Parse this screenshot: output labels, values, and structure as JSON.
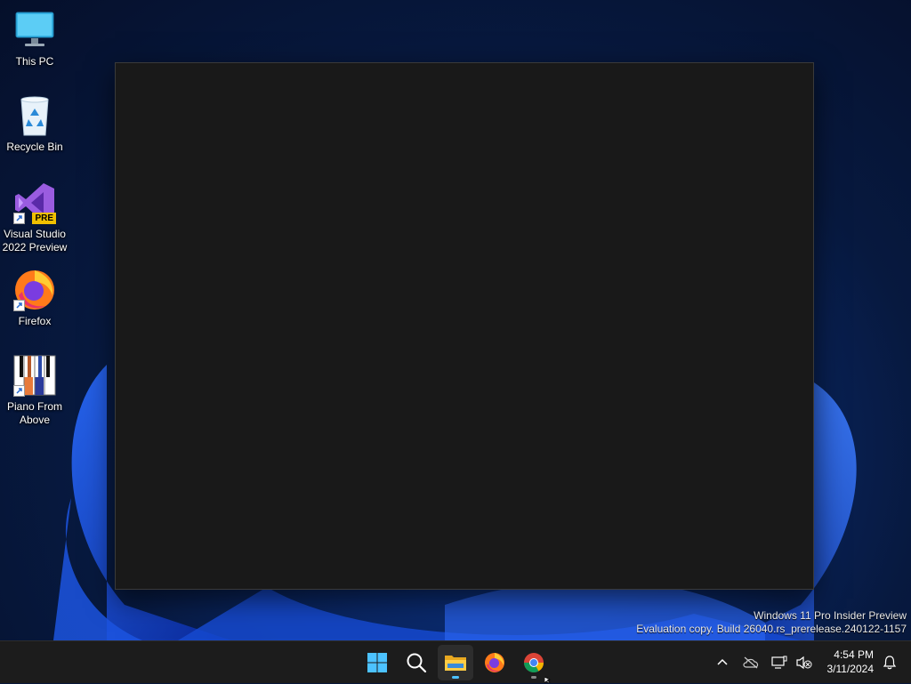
{
  "desktop": {
    "icons": [
      {
        "label": "This PC",
        "icon": "monitor-icon"
      },
      {
        "label": "Recycle Bin",
        "icon": "recycle-bin-icon"
      },
      {
        "label": "Visual Studio 2022 Preview",
        "icon": "visual-studio-icon",
        "badge": "PRE"
      },
      {
        "label": "Firefox",
        "icon": "firefox-icon"
      },
      {
        "label": "Piano From Above",
        "icon": "piano-icon"
      }
    ]
  },
  "watermark": {
    "line1": "Windows 11 Pro Insider Preview",
    "line2": "Evaluation copy. Build 26040.rs_prerelease.240122-1157"
  },
  "taskbar": {
    "apps": [
      {
        "icon": "windows-start-icon"
      },
      {
        "icon": "search-icon"
      },
      {
        "icon": "file-explorer-icon",
        "active": true
      },
      {
        "icon": "firefox-icon"
      },
      {
        "icon": "chrome-icon",
        "running": true
      }
    ],
    "tray": {
      "icons": [
        "chevron-up-icon",
        "onedrive-icon",
        "network-icon",
        "volume-muted-icon"
      ],
      "time": "4:54 PM",
      "date": "3/11/2024",
      "notification_icon": "bell-icon"
    }
  },
  "colors": {
    "accent": "#4cc2ff",
    "taskbar": "#1c1c1c",
    "window": "#191919"
  }
}
